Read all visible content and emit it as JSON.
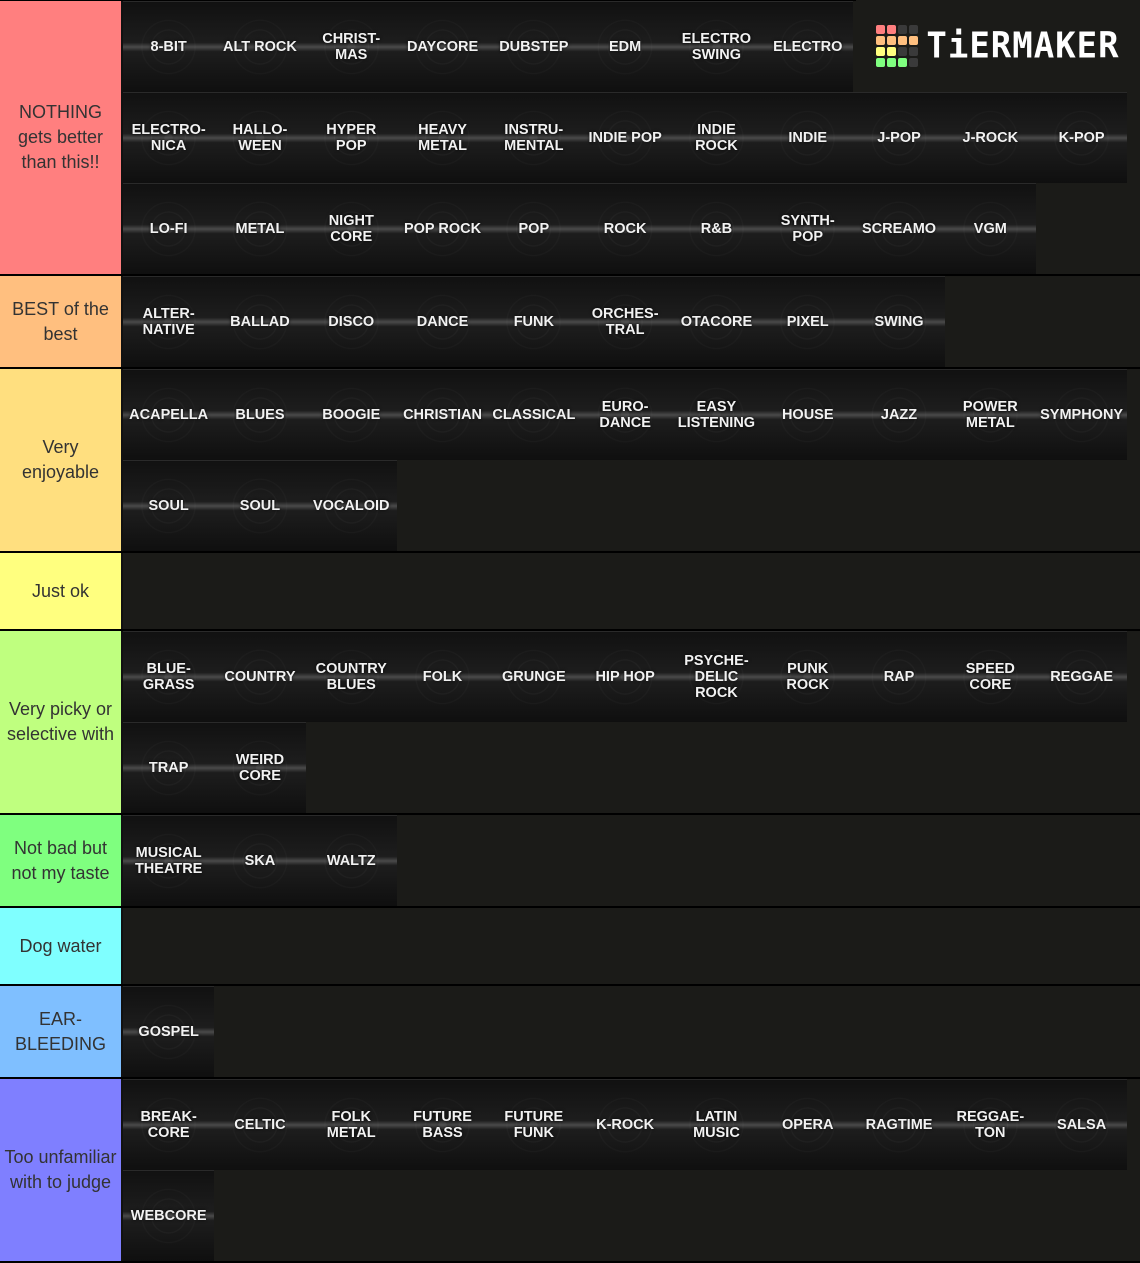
{
  "logo": {
    "text": "TiERMAKER",
    "grid_colors": [
      "#ff7f7f",
      "#ff7f7f",
      "#3a3a3a",
      "#3a3a3a",
      "#ffbf7f",
      "#ffbf7f",
      "#ffbf7f",
      "#ffbf7f",
      "#ffff7f",
      "#ffff7f",
      "#3a3a3a",
      "#3a3a3a",
      "#7fff7f",
      "#7fff7f",
      "#7fff7f",
      "#3a3a3a"
    ]
  },
  "tiers": [
    {
      "label": "NOTHING gets better than this!!",
      "color": "#ff7f7f",
      "items": [
        "8-BIT",
        "ALT ROCK",
        "CHRIST-\nMAS",
        "DAYCORE",
        "DUBSTEP",
        "EDM",
        "ELECTRO\nSWING",
        "ELECTRO",
        "ELECTRO-\nNICA",
        "HALLO-\nWEEN",
        "HYPER\nPOP",
        "HEAVY\nMETAL",
        "INSTRU-\nMENTAL",
        "INDIE POP",
        "INDIE\nROCK",
        "INDIE",
        "J-POP",
        "J-ROCK",
        "K-POP",
        "LO-FI",
        "METAL",
        "NIGHT\nCORE",
        "POP ROCK",
        "POP",
        "ROCK",
        "R&B",
        "SYNTH-\nPOP",
        "SCREAMO",
        "VGM"
      ]
    },
    {
      "label": "BEST of the best",
      "color": "#ffbf7f",
      "items": [
        "ALTER-\nNATIVE",
        "BALLAD",
        "DISCO",
        "DANCE",
        "FUNK",
        "ORCHES-\nTRAL",
        "OTACORE",
        "PIXEL",
        "SWING"
      ]
    },
    {
      "label": "Very enjoyable",
      "color": "#ffdf7f",
      "items": [
        "ACAPELLA",
        "BLUES",
        "BOOGIE",
        "CHRISTIAN",
        "CLASSICAL",
        "EURO-\nDANCE",
        "EASY\nLISTENING",
        "HOUSE",
        "JAZZ",
        "POWER\nMETAL",
        "SYMPHONY",
        "SOUL",
        "SOUL",
        "VOCALOID"
      ]
    },
    {
      "label": "Just ok",
      "color": "#ffff7f",
      "items": []
    },
    {
      "label": "Very picky or selective with",
      "color": "#bfff7f",
      "items": [
        "BLUE-\nGRASS",
        "COUNTRY",
        "COUNTRY\nBLUES",
        "FOLK",
        "GRUNGE",
        "HIP HOP",
        "PSYCHE-\nDELIC\nROCK",
        "PUNK\nROCK",
        "RAP",
        "SPEED\nCORE",
        "REGGAE",
        "TRAP",
        "WEIRD\nCORE"
      ]
    },
    {
      "label": "Not bad but not my taste",
      "color": "#7fff7f",
      "items": [
        "MUSICAL\nTHEATRE",
        "SKA",
        "WALTZ"
      ]
    },
    {
      "label": "Dog water",
      "color": "#7fffff",
      "items": []
    },
    {
      "label": "EAR-BLEEDING",
      "color": "#7fbfff",
      "items": [
        "GOSPEL"
      ]
    },
    {
      "label": "Too unfamiliar with to judge",
      "color": "#7f7fff",
      "items": [
        "BREAK-\nCORE",
        "CELTIC",
        "FOLK\nMETAL",
        "FUTURE\nBASS",
        "FUTURE\nFUNK",
        "K-ROCK",
        "LATIN\nMUSIC",
        "OPERA",
        "RAGTIME",
        "REGGAE-\nTON",
        "SALSA",
        "WEBCORE"
      ]
    }
  ]
}
